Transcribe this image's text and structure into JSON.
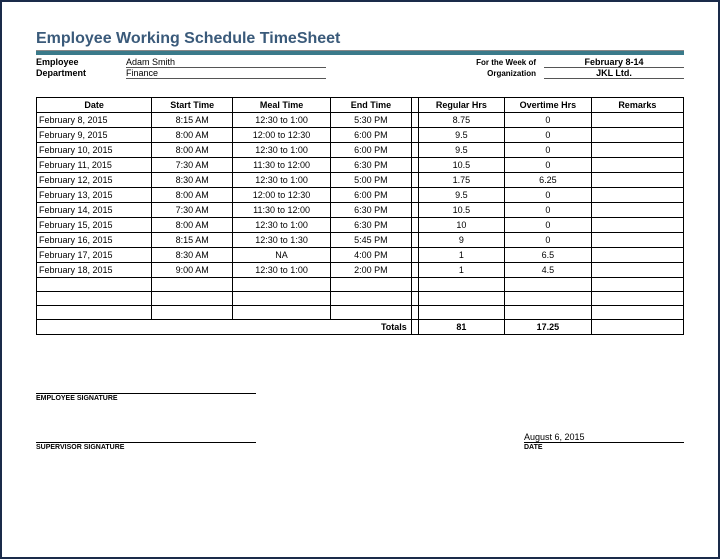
{
  "title": "Employee Working Schedule TimeSheet",
  "meta": {
    "employee_label": "Employee",
    "employee_value": "Adam Smith",
    "department_label": "Department",
    "department_value": "Finance",
    "week_label": "For the Week of",
    "week_value": "February 8-14",
    "org_label": "Organization",
    "org_value": "JKL Ltd."
  },
  "columns": {
    "date": "Date",
    "start": "Start Time",
    "meal": "Meal Time",
    "end": "End Time",
    "regular": "Regular Hrs",
    "overtime": "Overtime Hrs",
    "remarks": "Remarks"
  },
  "rows": [
    {
      "date": "February 8, 2015",
      "start": "8:15 AM",
      "meal": "12:30 to 1:00",
      "end": "5:30 PM",
      "regular": "8.75",
      "overtime": "0",
      "remarks": ""
    },
    {
      "date": "February 9, 2015",
      "start": "8:00 AM",
      "meal": "12:00 to 12:30",
      "end": "6:00 PM",
      "regular": "9.5",
      "overtime": "0",
      "remarks": ""
    },
    {
      "date": "February 10, 2015",
      "start": "8:00 AM",
      "meal": "12:30 to 1:00",
      "end": "6:00 PM",
      "regular": "9.5",
      "overtime": "0",
      "remarks": ""
    },
    {
      "date": "February 11, 2015",
      "start": "7:30 AM",
      "meal": "11:30 to 12:00",
      "end": "6:30 PM",
      "regular": "10.5",
      "overtime": "0",
      "remarks": ""
    },
    {
      "date": "February 12, 2015",
      "start": "8:30 AM",
      "meal": "12:30 to 1:00",
      "end": "5:00 PM",
      "regular": "1.75",
      "overtime": "6.25",
      "remarks": ""
    },
    {
      "date": "February 13, 2015",
      "start": "8:00 AM",
      "meal": "12:00 to 12:30",
      "end": "6:00 PM",
      "regular": "9.5",
      "overtime": "0",
      "remarks": ""
    },
    {
      "date": "February 14, 2015",
      "start": "7:30 AM",
      "meal": "11:30 to 12:00",
      "end": "6:30 PM",
      "regular": "10.5",
      "overtime": "0",
      "remarks": ""
    },
    {
      "date": "February 15, 2015",
      "start": "8:00 AM",
      "meal": "12:30 to 1:00",
      "end": "6:30 PM",
      "regular": "10",
      "overtime": "0",
      "remarks": ""
    },
    {
      "date": "February 16, 2015",
      "start": "8:15 AM",
      "meal": "12:30 to 1:30",
      "end": "5:45 PM",
      "regular": "9",
      "overtime": "0",
      "remarks": ""
    },
    {
      "date": "February 17, 2015",
      "start": "8:30 AM",
      "meal": "NA",
      "end": "4:00 PM",
      "regular": "1",
      "overtime": "6.5",
      "remarks": ""
    },
    {
      "date": "February 18, 2015",
      "start": "9:00 AM",
      "meal": "12:30 to 1:00",
      "end": "2:00 PM",
      "regular": "1",
      "overtime": "4.5",
      "remarks": ""
    }
  ],
  "totals": {
    "label": "Totals",
    "regular": "81",
    "overtime": "17.25"
  },
  "signatures": {
    "employee": "EMPLOYEE SIGNATURE",
    "supervisor": "SUPERVISOR SIGNATURE",
    "date_label": "DATE",
    "date_value": "August 6, 2015"
  }
}
